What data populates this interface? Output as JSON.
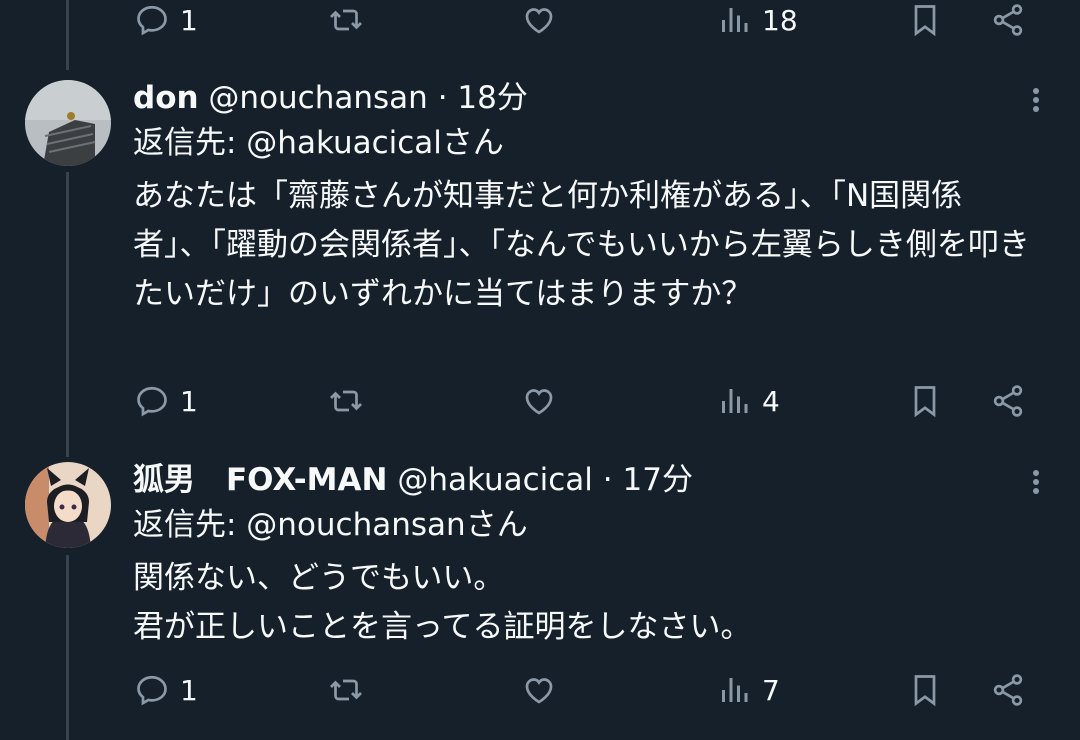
{
  "top_actions": {
    "replies": "1",
    "views": "18"
  },
  "tweets": [
    {
      "name": "don",
      "handle": "@nouchansan",
      "time": "18分",
      "reply_to": "返信先: @hakuacicalさん",
      "body": "あなたは「齋藤さんが知事だと何か利権がある」、「N国関係者」、「躍動の会関係者」、「なんでもいいから左翼らしき側を叩きたいだけ」のいずれかに当てはまりますか？",
      "replies": "1",
      "views": "4"
    },
    {
      "name": "狐男　FOX-MAN",
      "handle": "@hakuacical",
      "time": "17分",
      "reply_to": "返信先: @nouchansanさん",
      "body_lines": [
        "関係ない、どうでもいい。",
        "君が正しいことを言ってる証明をしなさい。"
      ],
      "replies": "1",
      "views": "7"
    }
  ],
  "colors": {
    "background": "#15202b",
    "text": "#f7f9f9",
    "icon": "#8b98a5",
    "thread_line": "#38444d"
  }
}
